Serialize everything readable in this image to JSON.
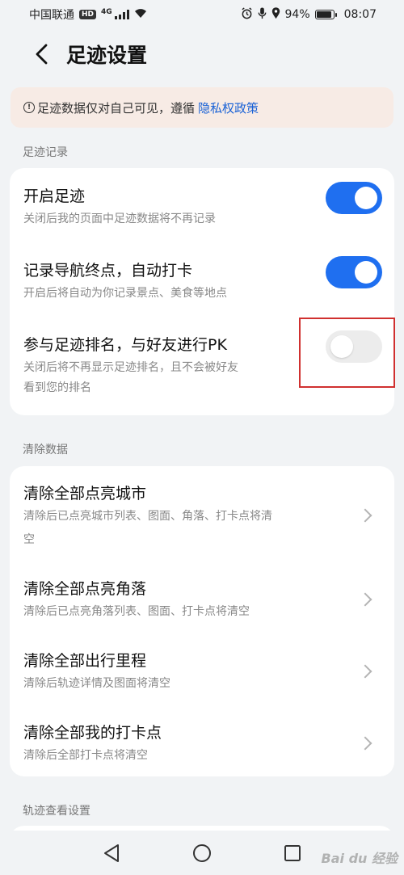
{
  "status_bar": {
    "carrier": "中国联通",
    "hd": "HD",
    "network": "4G",
    "battery": "94%",
    "battery_level": 0.94,
    "time": "08:07"
  },
  "header": {
    "title": "足迹设置"
  },
  "notice": {
    "text": "足迹数据仅对自己可见，遵循",
    "link": "隐私权政策"
  },
  "sections": {
    "footprint_record": {
      "label": "足迹记录",
      "items": [
        {
          "title": "开启足迹",
          "subtitle": "关闭后我的页面中足迹数据将不再记录",
          "toggle": "on"
        },
        {
          "title": "记录导航终点，自动打卡",
          "subtitle": "开启后将自动为你记录景点、美食等地点",
          "toggle": "on"
        },
        {
          "title": "参与足迹排名，与好友进行PK",
          "subtitle_line1": "关闭后将不再显示足迹排名，且不会被好友",
          "subtitle_line2": "看到您的排名",
          "toggle": "off"
        }
      ]
    },
    "clear_data": {
      "label": "清除数据",
      "items": [
        {
          "title": "清除全部点亮城市",
          "subtitle_line1": "清除后已点亮城市列表、图面、角落、打卡点将清",
          "subtitle_line2": "空"
        },
        {
          "title": "清除全部点亮角落",
          "subtitle": "清除后已点亮角落列表、图面、打卡点将清空"
        },
        {
          "title": "清除全部出行里程",
          "subtitle": "清除后轨迹详情及图面将清空"
        },
        {
          "title": "清除全部我的打卡点",
          "subtitle": "清除后全部打卡点将清空"
        }
      ]
    },
    "track_view": {
      "label": "轨迹查看设置"
    }
  },
  "watermark": "Bai du 经验",
  "colors": {
    "accent": "#1f6ff0",
    "link": "#1a62d6",
    "highlight": "#d0302f",
    "notice_bg": "#f7ebe5"
  },
  "icons": {
    "back": "back-arrow-icon",
    "nav_back": "triangle-back-icon",
    "nav_home": "circle-home-icon",
    "nav_recent": "square-recent-icon"
  }
}
